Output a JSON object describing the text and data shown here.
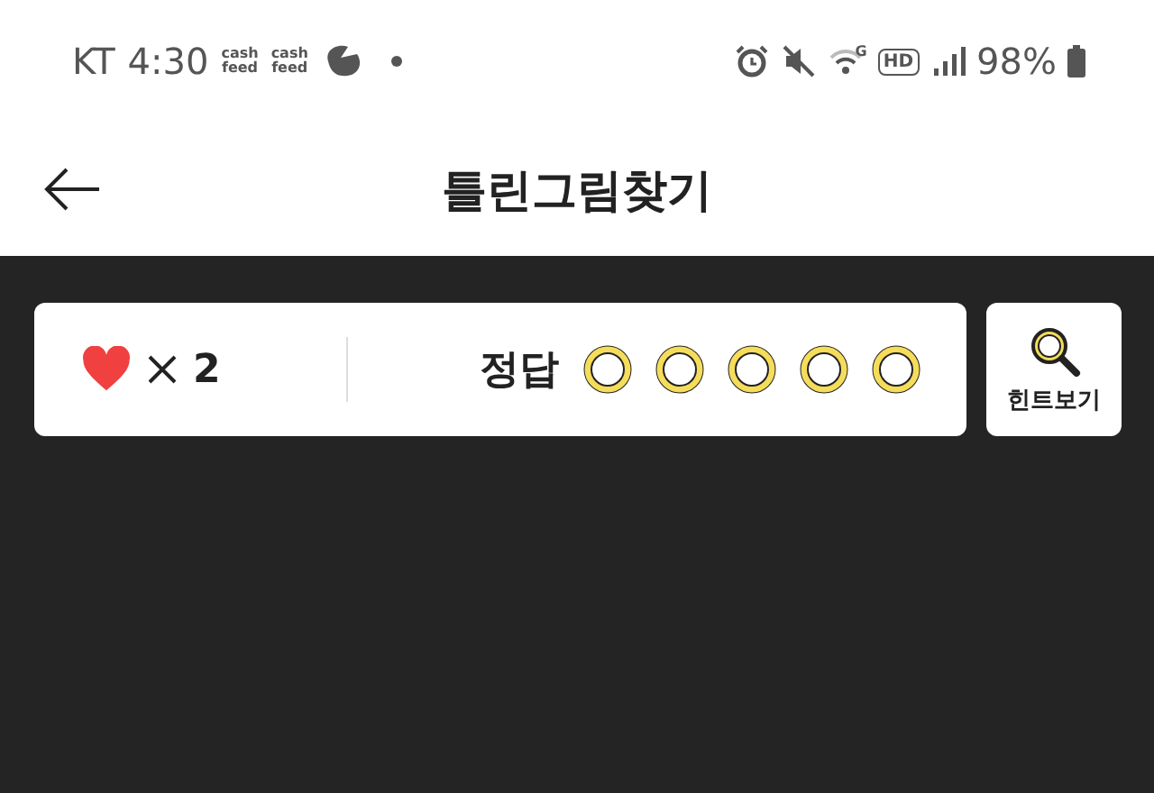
{
  "status_bar": {
    "carrier": "KT",
    "time": "4:30",
    "notifications": [
      {
        "kind": "cashfeed",
        "line1": "cash",
        "line2": "feed"
      },
      {
        "kind": "cashfeed",
        "line1": "cash",
        "line2": "feed"
      },
      {
        "kind": "app"
      },
      {
        "kind": "dot"
      }
    ],
    "network": "G",
    "hd": "HD",
    "battery": "98%"
  },
  "header": {
    "title": "틀린그림찾기"
  },
  "score": {
    "lives": "2",
    "answer_label": "정답",
    "answers": [
      {
        "found": false
      },
      {
        "found": false
      },
      {
        "found": false
      },
      {
        "found": false
      },
      {
        "found": false
      }
    ]
  },
  "hint_button": {
    "label": "힌트보기"
  }
}
